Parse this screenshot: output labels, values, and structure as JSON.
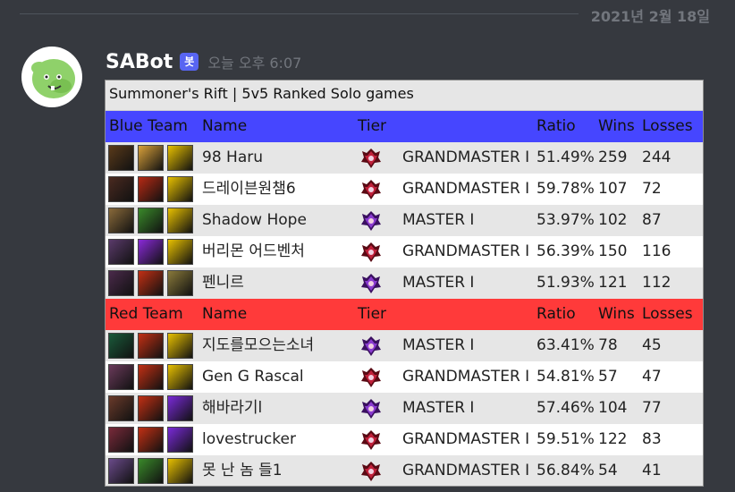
{
  "date_divider": "2021년 2월 18일",
  "message": {
    "username": "SABot",
    "bot_tag": "봇",
    "timestamp": "오늘 오후 6:07",
    "avatar_icon": "green-mascot-avatar"
  },
  "table": {
    "title": "Summoner's Rift | 5v5 Ranked Solo games",
    "blue_header": {
      "team": "Blue Team",
      "name": "Name",
      "tier": "Tier",
      "ratio": "Ratio",
      "wins": "Wins",
      "losses": "Losses"
    },
    "red_header": {
      "team": "Red Team",
      "name": "Name",
      "tier": "Tier",
      "ratio": "Ratio",
      "wins": "Wins",
      "losses": "Losses"
    },
    "blue_players": [
      {
        "name": "98 Haru",
        "tier": "GRANDMASTER I",
        "ratio": "51.49%",
        "wins": "259",
        "losses": "244"
      },
      {
        "name": "드레이븐원챔6",
        "tier": "GRANDMASTER I",
        "ratio": "59.78%",
        "wins": "107",
        "losses": "72"
      },
      {
        "name": "Shadow Hope",
        "tier": "MASTER I",
        "ratio": "53.97%",
        "wins": "102",
        "losses": "87"
      },
      {
        "name": "버리몬 어드벤처",
        "tier": "GRANDMASTER I",
        "ratio": "56.39%",
        "wins": "150",
        "losses": "116"
      },
      {
        "name": "펜니르",
        "tier": "MASTER I",
        "ratio": "51.93%",
        "wins": "121",
        "losses": "112"
      }
    ],
    "red_players": [
      {
        "name": "지도를모으는소녀",
        "tier": "MASTER I",
        "ratio": "63.41%",
        "wins": "78",
        "losses": "45"
      },
      {
        "name": "Gen G Rascal",
        "tier": "GRANDMASTER I",
        "ratio": "54.81%",
        "wins": "57",
        "losses": "47"
      },
      {
        "name": "해바라기l",
        "tier": "MASTER I",
        "ratio": "57.46%",
        "wins": "104",
        "losses": "77"
      },
      {
        "name": "lovestrucker",
        "tier": "GRANDMASTER I",
        "ratio": "59.51%",
        "wins": "122",
        "losses": "83"
      },
      {
        "name": "못 난 놈 들1",
        "tier": "GRANDMASTER I",
        "ratio": "56.84%",
        "wins": "54",
        "losses": "41"
      }
    ]
  }
}
